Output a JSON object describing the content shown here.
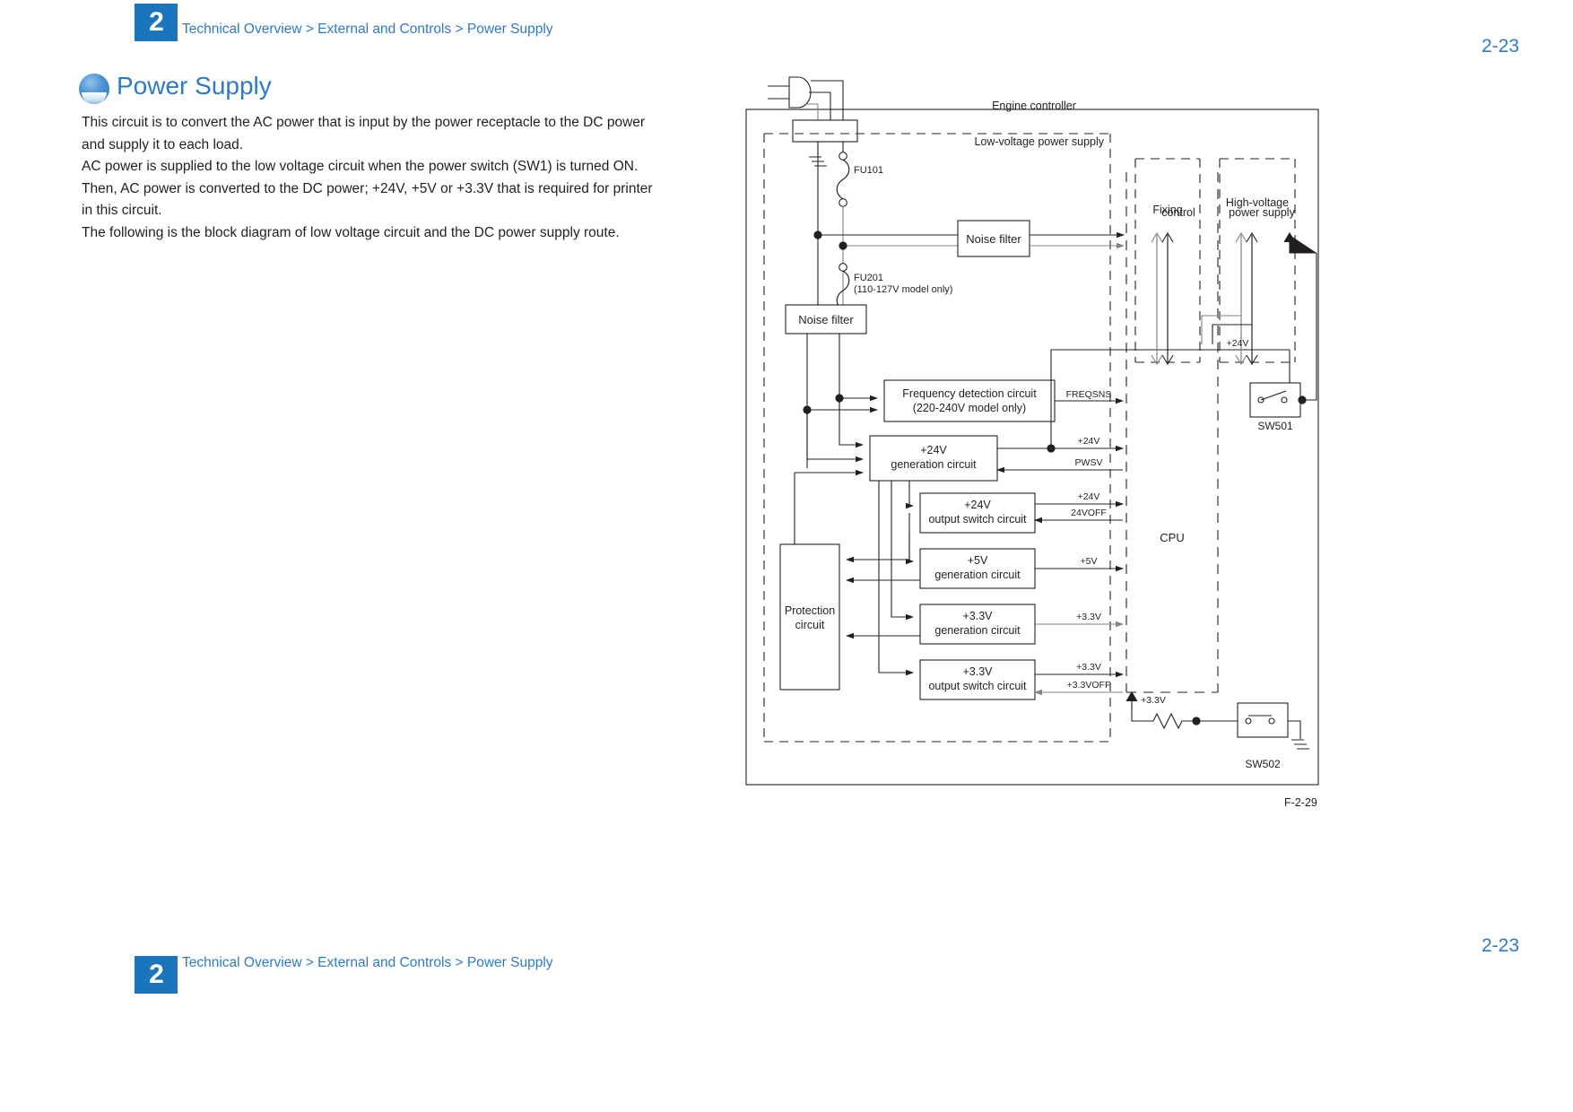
{
  "header": {
    "chapter_number": "2",
    "breadcrumb": "Technical Overview > External and Controls > Power Supply",
    "page_number": "2-23"
  },
  "section": {
    "title": "Power Supply",
    "bullet_icon": "blue-sphere-bullet-icon"
  },
  "body": {
    "lines": [
      "This circuit is to convert the AC power that is input by the power receptacle to the DC power",
      "and supply it to each load.",
      "AC power is supplied to the low voltage circuit when the power switch (SW1) is turned ON.",
      "Then, AC power is converted to the DC power; +24V, +5V or +3.3V that is required for printer",
      "in this circuit.",
      "The following is the block diagram of low voltage circuit and the DC power supply route."
    ]
  },
  "figure": {
    "caption": "F-2-29",
    "region_labels": {
      "engine_controller": "Engine controller",
      "low_voltage_power_supply": "Low-voltage power supply",
      "fixing_control": "Fixing control",
      "high_voltage_power_supply": "High-voltage power supply",
      "cpu": "CPU"
    },
    "components": {
      "fuse_1": "FU101",
      "fuse_2": "FU201",
      "fuse_2_note": "(110-127V model only)",
      "noise_filter_top": "Noise filter",
      "noise_filter_left": "Noise filter",
      "frequency_detection_line1": "Frequency detection circuit",
      "frequency_detection_line2": "(220-240V model only)",
      "gen_24v_line1": "+24V",
      "gen_24v_line2": "generation circuit",
      "out_24v_line1": "+24V",
      "out_24v_line2": "output switch circuit",
      "gen_5v_line1": "+5V",
      "gen_5v_line2": "generation circuit",
      "gen_33v_line1": "+3.3V",
      "gen_33v_line2": "generation circuit",
      "out_33v_line1": "+3.3V",
      "out_33v_line2": "output switch circuit",
      "protection_line1": "Protection",
      "protection_line2": "circuit",
      "switch_501": "SW501",
      "switch_502": "SW502"
    },
    "signals": {
      "freqsns": "FREQSNS",
      "v24_a": "+24V",
      "pwsv": "PWSV",
      "v24_b": "+24V",
      "v24off": "24VOFF",
      "v5": "+5V",
      "v33_a": "+3.3V",
      "v33_b": "+3.3V",
      "v33off": "+3.3VOFF",
      "v24_hv": "+24V",
      "v33_sw502": "+3.3V"
    }
  },
  "footer": {
    "chapter_number": "2",
    "breadcrumb": "Technical Overview > External and Controls > Power Supply",
    "page_number": "2-23"
  },
  "colors": {
    "accent_blue": "#2e7bc4",
    "chapter_tab_blue": "#1b75bc",
    "body_text": "#231f20",
    "line_black": "#231f20",
    "line_gray": "#808285"
  }
}
